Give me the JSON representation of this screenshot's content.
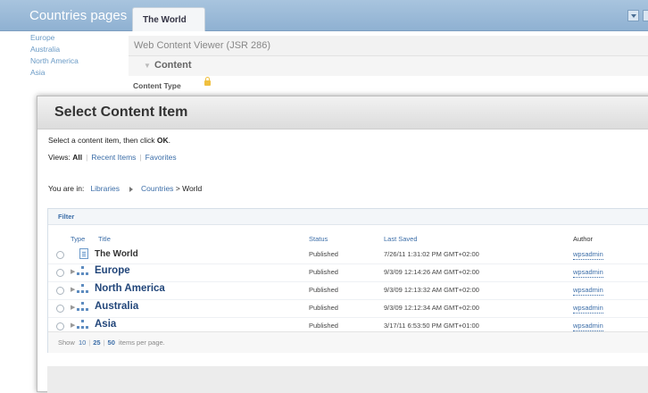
{
  "topbar": {
    "site_title": "Countries pages",
    "tab_label": "The World"
  },
  "left_nav": {
    "items": [
      "Europe",
      "Australia",
      "North America",
      "Asia"
    ]
  },
  "portlet": {
    "title": "Web Content Viewer (JSR 286)",
    "section": "Content",
    "content_type_label": "Content Type"
  },
  "dialog": {
    "title": "Select Content Item",
    "instruction_prefix": "Select a content item, then click ",
    "instruction_ok": "OK",
    "instruction_suffix": ".",
    "views_label": "Views:",
    "views": [
      "All",
      "Recent Items",
      "Favorites"
    ],
    "path_label": "You are in:",
    "path_root": "Libraries",
    "path_library": "Countries",
    "path_sep": ">",
    "path_current": "World",
    "filter_label": "Filter",
    "columns": [
      "Type",
      "Title",
      "Status",
      "Last Saved",
      "Author"
    ],
    "rows": [
      {
        "title": "The World",
        "status": "Published",
        "saved": "7/26/11 1:31:02 PM GMT+02:00",
        "author": "wpsadmin"
      },
      {
        "title": "Europe",
        "status": "Published",
        "saved": "9/3/09 12:14:26 AM GMT+02:00",
        "author": "wpsadmin"
      },
      {
        "title": "North America",
        "status": "Published",
        "saved": "9/3/09 12:13:32 AM GMT+02:00",
        "author": "wpsadmin"
      },
      {
        "title": "Australia",
        "status": "Published",
        "saved": "9/3/09 12:12:34 AM GMT+02:00",
        "author": "wpsadmin"
      },
      {
        "title": "Asia",
        "status": "Published",
        "saved": "3/17/11 6:53:50 PM GMT+01:00",
        "author": "wpsadmin"
      }
    ],
    "pager": {
      "show_label": "Show",
      "size_10": "10",
      "size_25": "25",
      "size_50": "50",
      "suffix": "items per page."
    }
  }
}
